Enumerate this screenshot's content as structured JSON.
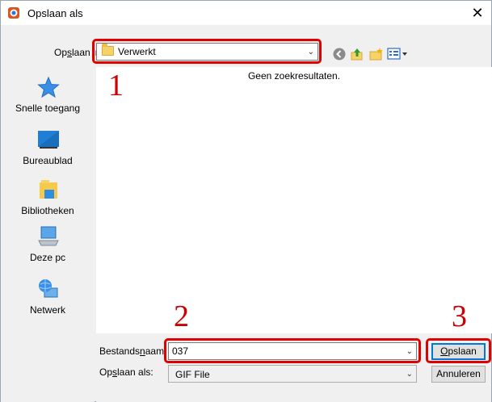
{
  "window": {
    "title": "Opslaan als",
    "close_label": "✕"
  },
  "save_in": {
    "label_pre": "Op",
    "label_accel": "s",
    "label_post": "laan in:",
    "value": "Verwerkt"
  },
  "file_list": {
    "empty_message": "Geen zoekresultaten."
  },
  "places": [
    {
      "label": "Snelle toegang",
      "icon": "quick-access-star-icon"
    },
    {
      "label": "Bureaublad",
      "icon": "desktop-icon"
    },
    {
      "label": "Bibliotheken",
      "icon": "libraries-icon"
    },
    {
      "label": "Deze pc",
      "icon": "this-pc-icon"
    },
    {
      "label": "Netwerk",
      "icon": "network-icon"
    }
  ],
  "filename": {
    "label_pre": "Bestands",
    "label_accel": "n",
    "label_post": "aam:",
    "value": "037"
  },
  "filetype": {
    "label_pre": "Op",
    "label_accel": "s",
    "label_post": "laan als:",
    "value": "GIF File"
  },
  "buttons": {
    "save_pre": "",
    "save_accel": "O",
    "save_post": "pslaan",
    "cancel": "Annuleren"
  },
  "annotations": [
    "1",
    "2",
    "3"
  ],
  "colors": {
    "highlight": "#e00000",
    "annotation_text": "#cc0000",
    "accent": "#0078d7"
  }
}
